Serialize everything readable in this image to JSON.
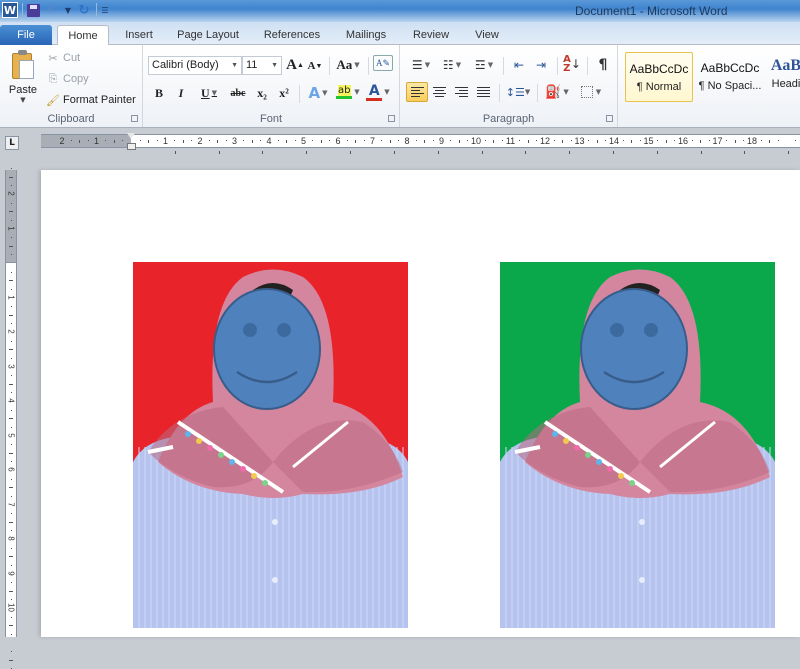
{
  "window": {
    "title": "Document1  -  Microsoft Word",
    "quick_access": [
      "word-logo",
      "save-icon",
      "undo-icon",
      "redo-icon",
      "customize-icon"
    ]
  },
  "tabs": [
    {
      "label": "File",
      "active": false
    },
    {
      "label": "Home",
      "active": true
    },
    {
      "label": "Insert",
      "active": false
    },
    {
      "label": "Page Layout",
      "active": false
    },
    {
      "label": "References",
      "active": false
    },
    {
      "label": "Mailings",
      "active": false
    },
    {
      "label": "Review",
      "active": false
    },
    {
      "label": "View",
      "active": false
    }
  ],
  "ribbon": {
    "clipboard": {
      "label": "Clipboard",
      "paste": "Paste",
      "cut": "Cut",
      "copy": "Copy",
      "format_painter": "Format Painter"
    },
    "font": {
      "label": "Font",
      "font_name": "Calibri (Body)",
      "font_size": "11",
      "grow": "A",
      "shrink": "A",
      "change_case": "Aa",
      "bold": "B",
      "italic": "I",
      "underline": "U",
      "strikethrough": "abc",
      "subscript": "x₂",
      "superscript": "x²",
      "text_effects": "A",
      "highlight": "ab",
      "font_color": "A",
      "highlight_color": "#22c32e",
      "font_color_value": "#d62d20"
    },
    "paragraph": {
      "label": "Paragraph",
      "pilcrow": "¶",
      "sort": "A↓Z",
      "active_alignment": "align-left"
    },
    "styles": [
      {
        "sample": "AaBbCcDc",
        "name": "¶ Normal",
        "active": true
      },
      {
        "sample": "AaBbCcDc",
        "name": "¶ No Spaci...",
        "active": false
      },
      {
        "sample": "AaB",
        "name": "Headi",
        "active": false
      }
    ]
  },
  "ruler": {
    "tab_selector": "L",
    "h_left_numbers": [
      "2",
      "1"
    ],
    "h_numbers": [
      "1",
      "2",
      "3",
      "4",
      "5",
      "6",
      "7",
      "8",
      "9",
      "10",
      "11",
      "12",
      "13",
      "14",
      "15",
      "16",
      "17",
      "18"
    ],
    "v_top_numbers": [
      "2",
      "1"
    ],
    "v_numbers": [
      "1",
      "2",
      "3",
      "4",
      "5",
      "6",
      "7",
      "8",
      "9",
      "10"
    ]
  },
  "document": {
    "photos": [
      {
        "background": "red",
        "background_color": "#e8242a",
        "face": "smiley-emoji"
      },
      {
        "background": "green",
        "background_color": "#0aa84b",
        "face": "smiley-emoji"
      }
    ],
    "colors": {
      "hijab": "#d4869f",
      "hijab_shadow": "#b8677f",
      "shirt": "#b6c3ef",
      "face": "#4f81bd",
      "face_border": "#385d8a",
      "feature": "#3d6a9e"
    }
  }
}
